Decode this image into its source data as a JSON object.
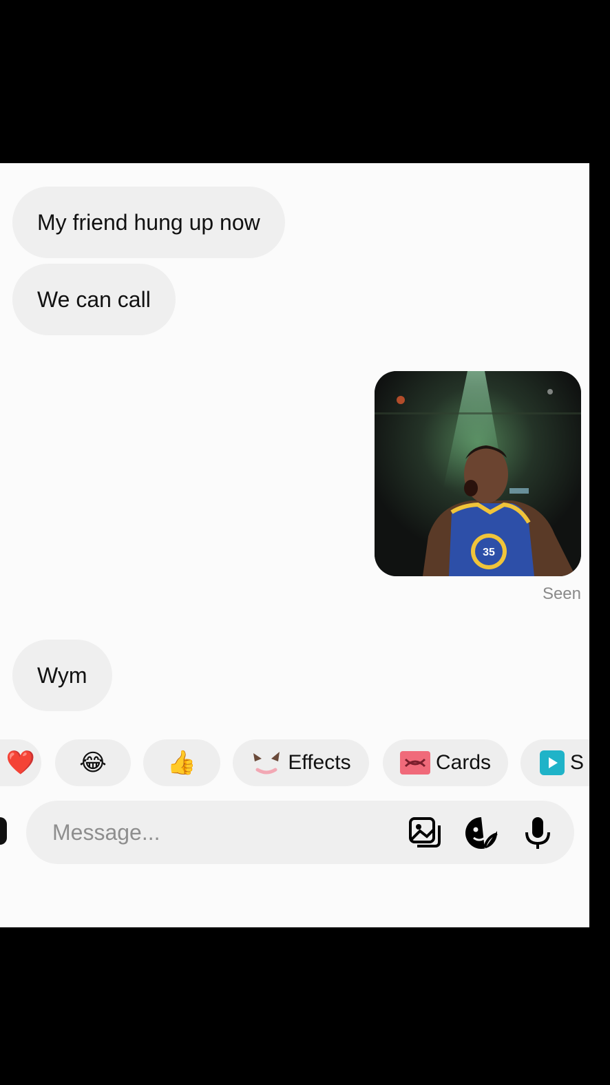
{
  "messages": {
    "incoming": [
      "My friend hung up now",
      "We can call",
      "Wym"
    ],
    "outgoing_status": "Seen"
  },
  "quick_replies": {
    "heart_emoji": "❤️",
    "laugh_emoji": "😂",
    "thumbs_emoji": "👍",
    "effects_label": "Effects",
    "cards_label": "Cards",
    "partial_label": "S"
  },
  "composer": {
    "placeholder": "Message..."
  },
  "colors": {
    "bubble_bg": "#efefef",
    "screen_bg": "#fbfbfb",
    "jersey_blue": "#2d4fa8",
    "jersey_gold": "#f0c43a",
    "cards_pink": "#f06a7a",
    "video_teal": "#1fb3c8"
  },
  "icons": [
    "photo-gallery-icon",
    "sticker-icon",
    "microphone-icon",
    "play-icon",
    "cards-icon",
    "effects-icon",
    "camera-icon"
  ]
}
